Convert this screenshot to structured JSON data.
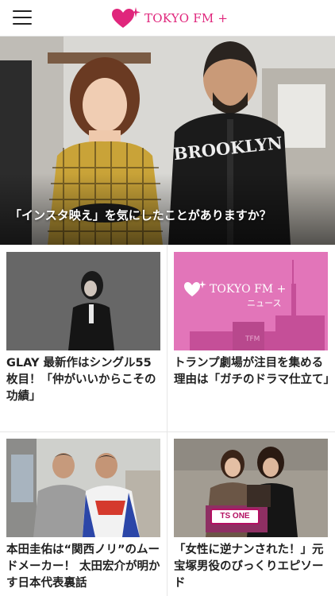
{
  "header": {
    "menu_icon": "hamburger-icon",
    "logo_icon": "tokyofm-heart-sparkle-icon",
    "logo_text": "TOKYO FM +",
    "brand_color": "#e0267c"
  },
  "hero": {
    "caption": "「インスタ映え」を気にしたことがありますか？",
    "shirt_text": "BROOKLYN"
  },
  "articles": [
    {
      "title": "GLAY 最新作はシングル55枚目！「仲がいいからこその功績」"
    },
    {
      "title": "トランプ劇場が注目を集める理由は「ガチのドラマ仕立て」",
      "thumb_logo": "TOKYO FM +",
      "thumb_sub": "ニュース",
      "thumb_color": "#e275b9"
    },
    {
      "title": "本田圭佑は“関西ノリ”のムードメーカー！ 太田宏介が明かす日本代表裏話"
    },
    {
      "title": "「女性に逆ナンされた！」元宝塚男役のびっくりエピソード",
      "thumb_label": "TS ONE"
    }
  ]
}
